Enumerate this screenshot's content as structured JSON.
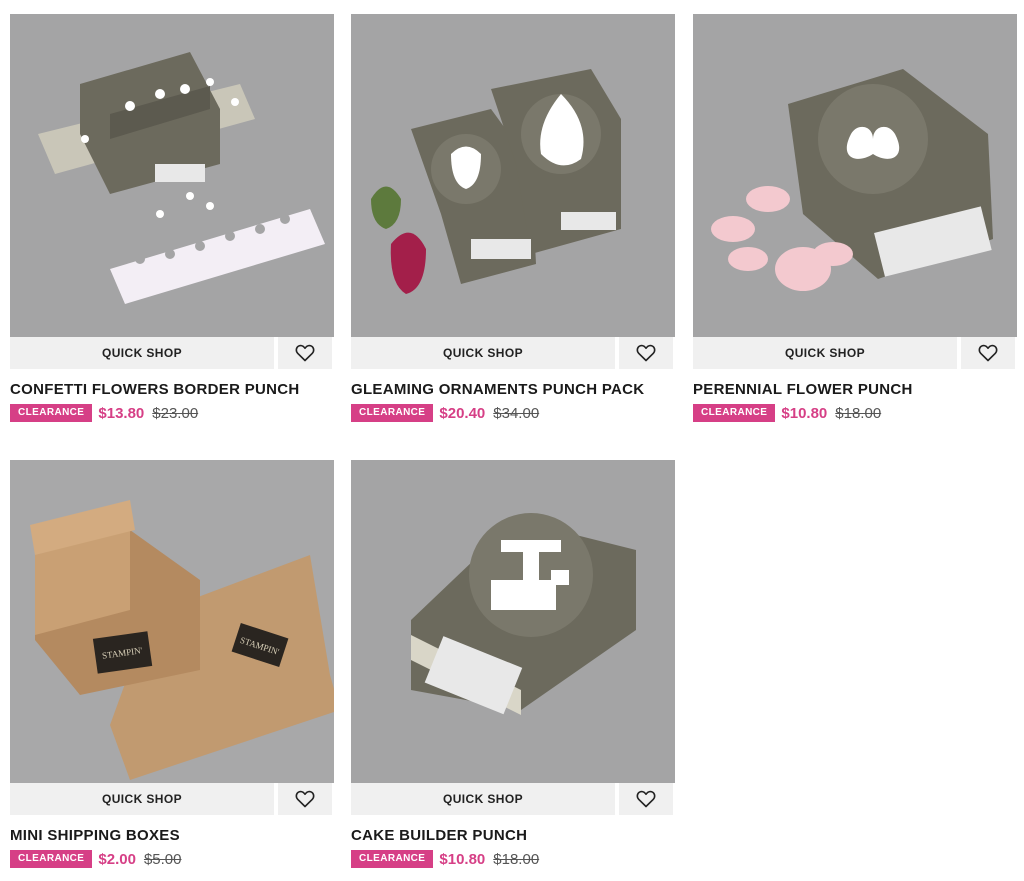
{
  "products": [
    {
      "title": "CONFETTI FLOWERS BORDER PUNCH",
      "badge": "CLEARANCE",
      "price": "$13.80",
      "old_price": "$23.00",
      "quick_shop": "QUICK SHOP",
      "image_desc": "confetti flowers border punch product photo"
    },
    {
      "title": "GLEAMING ORNAMENTS PUNCH PACK",
      "badge": "CLEARANCE",
      "price": "$20.40",
      "old_price": "$34.00",
      "quick_shop": "QUICK SHOP",
      "image_desc": "gleaming ornaments punch pack product photo"
    },
    {
      "title": "PERENNIAL FLOWER PUNCH",
      "badge": "CLEARANCE",
      "price": "$10.80",
      "old_price": "$18.00",
      "quick_shop": "QUICK SHOP",
      "image_desc": "perennial flower punch product photo"
    },
    {
      "title": "MINI SHIPPING BOXES",
      "badge": "CLEARANCE",
      "price": "$2.00",
      "old_price": "$5.00",
      "quick_shop": "QUICK SHOP",
      "image_desc": "mini shipping boxes product photo"
    },
    {
      "title": "CAKE BUILDER PUNCH",
      "badge": "CLEARANCE",
      "price": "$10.80",
      "old_price": "$18.00",
      "quick_shop": "QUICK SHOP",
      "image_desc": "cake builder punch product photo"
    }
  ],
  "colors": {
    "accent": "#d63f86",
    "punch_body": "#6c6a5d",
    "image_bg": "#a3a3a4",
    "button_bg": "#f0f0f0"
  },
  "icons": {
    "favorite": "heart-icon"
  }
}
